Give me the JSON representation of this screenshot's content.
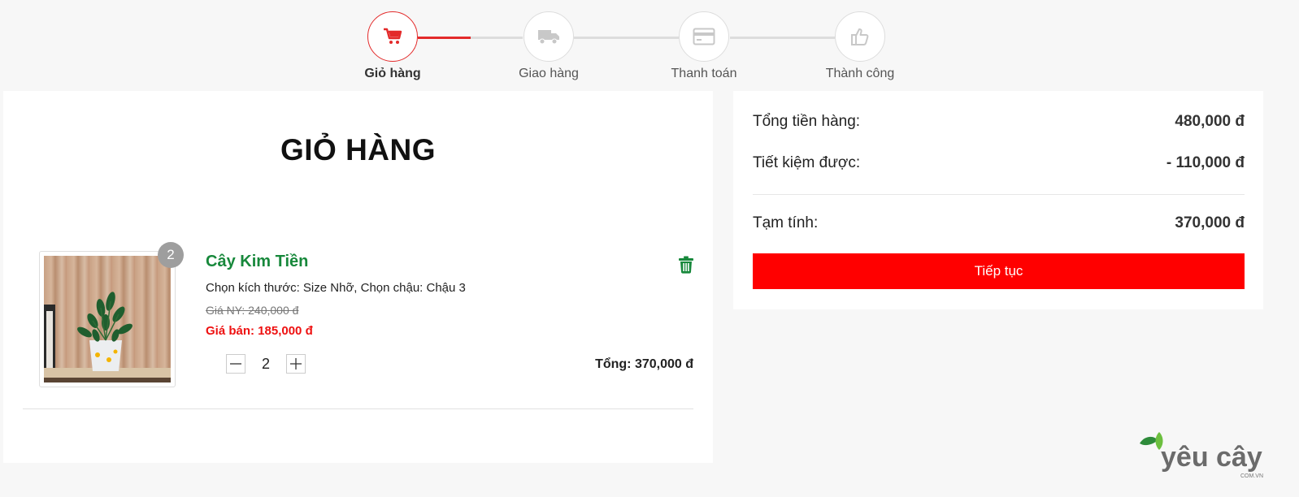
{
  "stepper": {
    "steps": [
      {
        "label": "Giỏ hàng",
        "icon": "cart-icon",
        "active": true
      },
      {
        "label": "Giao hàng",
        "icon": "truck-icon",
        "active": false
      },
      {
        "label": "Thanh toán",
        "icon": "credit-card-icon",
        "active": false
      },
      {
        "label": "Thành công",
        "icon": "thumbs-up-icon",
        "active": false
      }
    ],
    "active_color": "#e32a2a",
    "inactive_color": "#dddddd"
  },
  "cart": {
    "title": "GIỎ HÀNG",
    "items": [
      {
        "name": "Cây Kim Tiền",
        "quantity_badge": "2",
        "variant": "Chọn kích thước: Size Nhỡ, Chọn chậu: Chậu 3",
        "old_price": "Giá NY: 240,000 đ",
        "sale_price": "Giá bán: 185,000 đ",
        "quantity": "2",
        "total": "Tổng: 370,000 đ",
        "delete_icon": "trash-icon",
        "minus_icon": "minus-icon",
        "plus_icon": "plus-icon"
      }
    ]
  },
  "summary": {
    "subtotal_label": "Tổng tiền hàng:",
    "subtotal_value": "480,000 đ",
    "saving_label": "Tiết kiệm được:",
    "saving_value": "- 110,000 đ",
    "provisional_label": "Tạm tính:",
    "provisional_value": "370,000 đ",
    "continue_button": "Tiếp tục"
  },
  "logo": {
    "text": "yêu cây",
    "subtext": "COM.VN"
  },
  "colors": {
    "accent_red": "#ff0000",
    "product_green": "#17883b",
    "sale_red": "#ee1111"
  }
}
